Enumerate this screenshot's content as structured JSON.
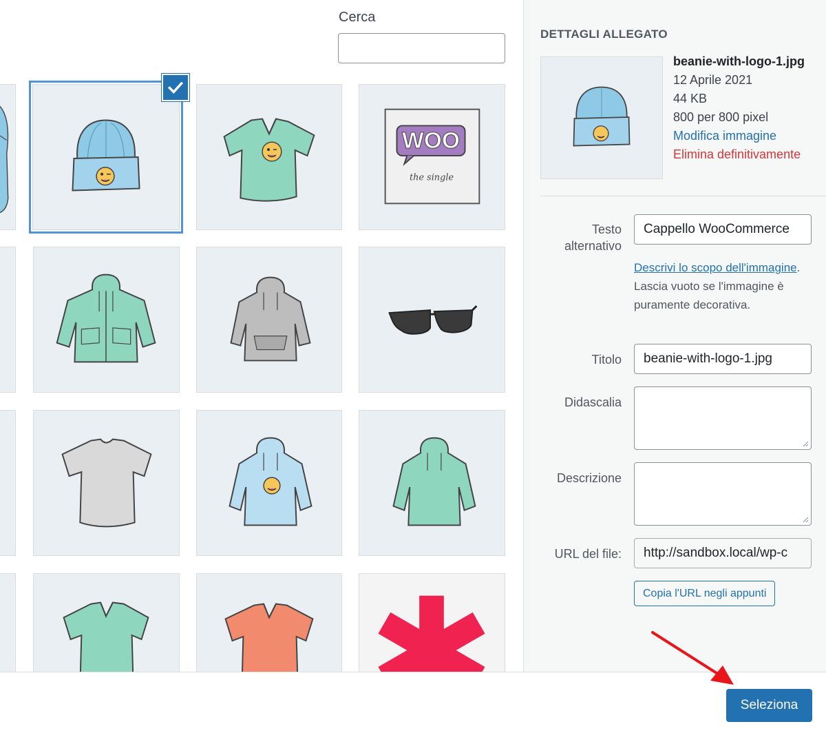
{
  "search": {
    "label": "Cerca",
    "value": ""
  },
  "details": {
    "heading": "DETTAGLI ALLEGATO",
    "file_name": "beanie-with-logo-1.jpg",
    "date": "12 Aprile 2021",
    "size": "44 KB",
    "dimensions": "800 per 800 pixel",
    "edit_link": "Modifica immagine",
    "delete_link": "Elimina definitivamente"
  },
  "fields": {
    "alt_label": "Testo alternativo",
    "alt_value": "Cappello WooCommerce",
    "alt_help_link": "Descrivi lo scopo dell'immagine",
    "alt_help_text": ". Lascia vuoto se l'immagine è puramente decorativa.",
    "title_label": "Titolo",
    "title_value": "beanie-with-logo-1.jpg",
    "caption_label": "Didascalia",
    "caption_value": "",
    "description_label": "Descrizione",
    "description_value": "",
    "url_label": "URL del file:",
    "url_value": "http://sandbox.local/wp-c",
    "copy_button": "Copia l'URL negli appunti"
  },
  "woo_logo_text": "WOO",
  "woo_script_text": "the single",
  "toolbar": {
    "select_button": "Seleziona"
  },
  "colors": {
    "accent": "#2271b1",
    "danger": "#d63638",
    "tile_bg": "#eaeff3",
    "annotation_arrow": "#e8161b"
  },
  "grid_items": [
    {
      "icon": "hoodie-partial-icon"
    },
    {
      "icon": "beanie-icon",
      "selected": true
    },
    {
      "icon": "vneck-tshirt-icon"
    },
    {
      "icon": "woo-album-icon"
    },
    {
      "icon": "partial-tile"
    },
    {
      "icon": "zip-hoodie-icon"
    },
    {
      "icon": "gray-hoodie-icon"
    },
    {
      "icon": "sunglasses-icon"
    },
    {
      "icon": "partial-tile"
    },
    {
      "icon": "gray-tshirt-icon"
    },
    {
      "icon": "blue-hoodie-logo-icon"
    },
    {
      "icon": "green-hoodie-icon"
    },
    {
      "icon": "partial-tile"
    },
    {
      "icon": "green-vneck-icon"
    },
    {
      "icon": "coral-vneck-icon"
    },
    {
      "icon": "asterisk-poster-icon"
    }
  ]
}
